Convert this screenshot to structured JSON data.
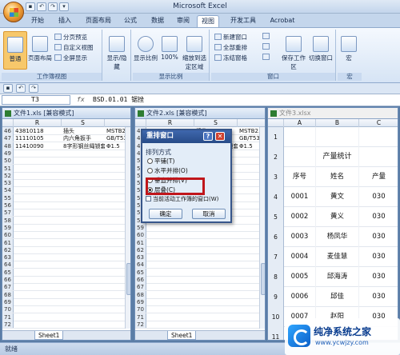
{
  "app": {
    "title": "Microsoft Excel",
    "tabs": [
      "开始",
      "插入",
      "页面布局",
      "公式",
      "数据",
      "审阅",
      "视图",
      "开发工具",
      "Acrobat"
    ],
    "active_tab": "视图"
  },
  "ribbon": {
    "workbook_views": {
      "label": "工作簿视图",
      "normal": "普通",
      "page_layout": "页面布局",
      "page_break": "分页预览",
      "custom_view": "自定义视图",
      "fullscreen": "全屏显示"
    },
    "show_hide": {
      "label": "显示/隐藏"
    },
    "zoom": {
      "label": "显示比例",
      "zoom_btn": "显示比例",
      "zoom_100": "100%",
      "zoom_selection": "缩放到选定区域"
    },
    "window": {
      "label": "窗口",
      "new_window": "新建窗口",
      "arrange_all": "全部重排",
      "freeze_panes": "冻结窗格",
      "save_workspace": "保存工作区",
      "switch_windows": "切换窗口"
    },
    "macros": {
      "label": "宏",
      "macro_btn": "宏"
    }
  },
  "formula_bar": {
    "name_box": "T3",
    "fx": "fx",
    "content": "BSD.01.01 锯挫"
  },
  "window1": {
    "title": "文件1.xls  [兼容模式]",
    "columns": [
      "R",
      "S"
    ],
    "rows": [
      {
        "n": "46",
        "r": "43810118",
        "s": "插头",
        "t": "MSTB2.5/"
      },
      {
        "n": "47",
        "r": "11110105",
        "s": "内六角扳手",
        "t": "GB/T5356"
      },
      {
        "n": "48",
        "r": "11410090",
        "s": "8字形钢丝绳锁套",
        "t": "Φ1.5"
      },
      {
        "n": "49",
        "r": "",
        "s": "",
        "t": ""
      },
      {
        "n": "50",
        "r": "",
        "s": "",
        "t": ""
      },
      {
        "n": "51",
        "r": "",
        "s": "",
        "t": ""
      },
      {
        "n": "52",
        "r": "",
        "s": "",
        "t": ""
      },
      {
        "n": "53",
        "r": "",
        "s": "",
        "t": ""
      },
      {
        "n": "54",
        "r": "",
        "s": "",
        "t": ""
      },
      {
        "n": "55",
        "r": "",
        "s": "",
        "t": ""
      },
      {
        "n": "56",
        "r": "",
        "s": "",
        "t": ""
      },
      {
        "n": "57",
        "r": "",
        "s": "",
        "t": ""
      },
      {
        "n": "58",
        "r": "",
        "s": "",
        "t": ""
      },
      {
        "n": "59",
        "r": "",
        "s": "",
        "t": ""
      },
      {
        "n": "60",
        "r": "",
        "s": "",
        "t": ""
      },
      {
        "n": "61",
        "r": "",
        "s": "",
        "t": ""
      },
      {
        "n": "62",
        "r": "",
        "s": "",
        "t": ""
      },
      {
        "n": "63",
        "r": "",
        "s": "",
        "t": ""
      },
      {
        "n": "64",
        "r": "",
        "s": "",
        "t": ""
      },
      {
        "n": "65",
        "r": "",
        "s": "",
        "t": ""
      },
      {
        "n": "66",
        "r": "",
        "s": "",
        "t": ""
      },
      {
        "n": "67",
        "r": "",
        "s": "",
        "t": ""
      },
      {
        "n": "68",
        "r": "",
        "s": "",
        "t": ""
      },
      {
        "n": "69",
        "r": "",
        "s": "",
        "t": ""
      },
      {
        "n": "70",
        "r": "",
        "s": "",
        "t": ""
      },
      {
        "n": "71",
        "r": "",
        "s": "",
        "t": ""
      },
      {
        "n": "72",
        "r": "",
        "s": "",
        "t": ""
      }
    ],
    "sheet_tab": "Sheet1"
  },
  "window2": {
    "title": "文件2.xls  [兼容模式]",
    "columns": [
      "R",
      "S"
    ],
    "rows": [
      {
        "n": "46",
        "r": "43810118",
        "s": "插头",
        "t": "MSTB2.5/"
      },
      {
        "n": "47",
        "r": "11110105",
        "s": "内六角扳手",
        "t": "GB/T5356"
      },
      {
        "n": "48",
        "r": "11410090",
        "s": "8字形钢丝绳锁套",
        "t": "Φ1.5"
      },
      {
        "n": "49",
        "r": "",
        "s": "",
        "t": ""
      },
      {
        "n": "50",
        "r": "",
        "s": "",
        "t": ""
      },
      {
        "n": "51",
        "r": "",
        "s": "",
        "t": ""
      },
      {
        "n": "52",
        "r": "",
        "s": "",
        "t": ""
      },
      {
        "n": "53",
        "r": "",
        "s": "",
        "t": ""
      },
      {
        "n": "54",
        "r": "",
        "s": "",
        "t": ""
      },
      {
        "n": "55",
        "r": "",
        "s": "",
        "t": ""
      },
      {
        "n": "56",
        "r": "",
        "s": "",
        "t": ""
      },
      {
        "n": "57",
        "r": "",
        "s": "",
        "t": ""
      },
      {
        "n": "58",
        "r": "",
        "s": "",
        "t": ""
      },
      {
        "n": "59",
        "r": "",
        "s": "",
        "t": ""
      },
      {
        "n": "60",
        "r": "",
        "s": "",
        "t": ""
      },
      {
        "n": "61",
        "r": "",
        "s": "",
        "t": ""
      },
      {
        "n": "62",
        "r": "",
        "s": "",
        "t": ""
      },
      {
        "n": "63",
        "r": "",
        "s": "",
        "t": ""
      },
      {
        "n": "64",
        "r": "",
        "s": "",
        "t": ""
      },
      {
        "n": "65",
        "r": "",
        "s": "",
        "t": ""
      },
      {
        "n": "66",
        "r": "",
        "s": "",
        "t": ""
      },
      {
        "n": "67",
        "r": "",
        "s": "",
        "t": ""
      },
      {
        "n": "68",
        "r": "",
        "s": "",
        "t": ""
      },
      {
        "n": "69",
        "r": "",
        "s": "",
        "t": ""
      },
      {
        "n": "70",
        "r": "",
        "s": "",
        "t": ""
      },
      {
        "n": "71",
        "r": "",
        "s": "",
        "t": ""
      },
      {
        "n": "72",
        "r": "",
        "s": "",
        "t": ""
      }
    ],
    "sheet_tab": "Sheet1"
  },
  "window3": {
    "title": "文件3.xlsx",
    "columns": [
      "A",
      "B",
      "C"
    ],
    "rows": [
      {
        "n": "1",
        "a": "",
        "b": "",
        "c": ""
      },
      {
        "n": "2",
        "a": "",
        "b": "产量统计",
        "c": ""
      },
      {
        "n": "3",
        "a": "序号",
        "b": "姓名",
        "c": "产量"
      },
      {
        "n": "4",
        "a": "0001",
        "b": "黄文",
        "c": "030"
      },
      {
        "n": "5",
        "a": "0002",
        "b": "黄义",
        "c": "030"
      },
      {
        "n": "6",
        "a": "0003",
        "b": "杨凤华",
        "c": "030"
      },
      {
        "n": "7",
        "a": "0004",
        "b": "麦佳慧",
        "c": "030"
      },
      {
        "n": "8",
        "a": "0005",
        "b": "邱海涛",
        "c": "030"
      },
      {
        "n": "9",
        "a": "0006",
        "b": "邱佳",
        "c": "030"
      },
      {
        "n": "10",
        "a": "0007",
        "b": "赵阳",
        "c": "030"
      },
      {
        "n": "11",
        "a": "",
        "b": "",
        "c": ""
      }
    ]
  },
  "dialog": {
    "title": "重排窗口",
    "group_label": "排列方式",
    "options": [
      "平铺(T)",
      "水平并排(O)",
      "垂直并排(V)",
      "层叠(C)"
    ],
    "selected_option": "层叠(C)",
    "checkbox_label": "当前活动工作簿的窗口(W)",
    "ok": "确定",
    "cancel": "取消"
  },
  "status_bar": {
    "text": "就绪"
  },
  "watermark": {
    "brand": "纯净系统之家",
    "url": "www.ycwjzy.com"
  }
}
